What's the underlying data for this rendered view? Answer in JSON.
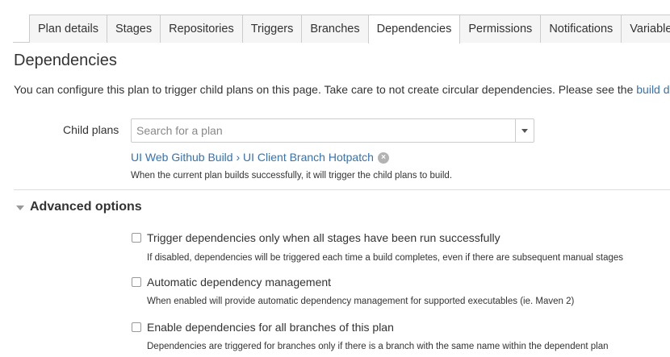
{
  "tabs": [
    {
      "label": "Plan details"
    },
    {
      "label": "Stages"
    },
    {
      "label": "Repositories"
    },
    {
      "label": "Triggers"
    },
    {
      "label": "Branches"
    },
    {
      "label": "Dependencies",
      "active": true
    },
    {
      "label": "Permissions"
    },
    {
      "label": "Notifications"
    },
    {
      "label": "Variables"
    }
  ],
  "page": {
    "title": "Dependencies",
    "intro_text": "You can configure this plan to trigger child plans on this page. Take care to not create circular dependencies. Please see the ",
    "intro_link": "build d"
  },
  "child_plans": {
    "label": "Child plans",
    "placeholder": "Search for a plan",
    "selected": "UI Web Github Build › UI Client Branch Hotpatch",
    "help": "When the current plan builds successfully, it will trigger the child plans to build."
  },
  "advanced": {
    "title": "Advanced options",
    "options": [
      {
        "label": "Trigger dependencies only when all stages have been run successfully",
        "help": "If disabled, dependencies will be triggered each time a build completes, even if there are subsequent manual stages",
        "checked": false
      },
      {
        "label": "Automatic dependency management",
        "help": "When enabled will provide automatic dependency management for supported executables (ie. Maven 2)",
        "checked": false
      },
      {
        "label": "Enable dependencies for all branches of this plan",
        "help": "Dependencies are triggered for branches only if there is a branch with the same name within the dependent plan",
        "checked": false
      }
    ]
  },
  "colors": {
    "link": "#3572b0",
    "border": "#cccccc"
  },
  "icons": {
    "remove": "remove-circle-icon",
    "dropdown": "chevron-down-icon",
    "collapse": "caret-down-icon"
  }
}
